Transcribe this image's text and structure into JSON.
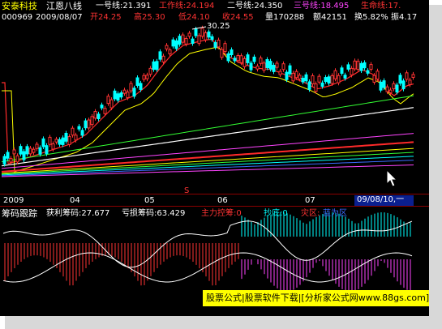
{
  "header": {
    "stock_name": "安泰科技",
    "indicator_name": "江恩八线",
    "lines": [
      {
        "label": "一号线:21.391",
        "color": "#ffffff"
      },
      {
        "label": "工作线:24.194",
        "color": "#ff3333"
      },
      {
        "label": "二号线:24.350",
        "color": "#ffffff"
      },
      {
        "label": "三号线:18.495",
        "color": "#ff44ff"
      },
      {
        "label": "生命线:17.",
        "color": "#ff3333"
      }
    ]
  },
  "quote": {
    "code": "000969",
    "date": "2009/08/07",
    "open": "开24.25",
    "high": "高25.30",
    "low": "低24.10",
    "close": "收24.55",
    "volume": "量170288",
    "amount": "额42151",
    "turnover": "换5.82%",
    "amplitude": "振4.17"
  },
  "price_annotation": "30.25",
  "marker_symbol": "S",
  "x_axis": {
    "labels": [
      "2009",
      "04",
      "05",
      "06",
      "07"
    ],
    "cursor_date": "09/08/10,一"
  },
  "sub_header": {
    "name": "筹码跟踪",
    "items": [
      {
        "label": "获利筹码:27.677",
        "color": "#ffffff"
      },
      {
        "label": "亏损筹码:63.429",
        "color": "#ffffff"
      },
      {
        "label": "主力控筹:0",
        "color": "#ff3333"
      },
      {
        "label": "抄底:0",
        "color": "#00ffff"
      },
      {
        "label": "灾区:",
        "color": "#ff3333"
      },
      {
        "label": "蓝为区",
        "color": "#3b6bff"
      }
    ]
  },
  "watermark": "股票公式|股票软件下载|[分析家公式网www.88gs.com]",
  "colors": {
    "background": "#000000",
    "separator": "#8b0000",
    "up_candle": "#ff3333",
    "down_candle": "#00ffff",
    "watermark_bg": "#ffff00"
  },
  "icons": [
    "cursor-arrow-icon",
    "up-arrow-icon"
  ]
}
